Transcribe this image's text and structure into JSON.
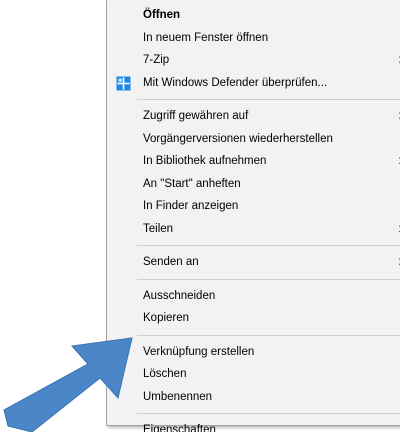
{
  "context_menu": {
    "groups": [
      [
        {
          "label": "Öffnen",
          "bold": true
        },
        {
          "label": "In neuem Fenster öffnen"
        },
        {
          "label": "7-Zip",
          "submenu": true
        },
        {
          "label": "Mit Windows Defender überprüfen...",
          "icon": "windows-defender-icon"
        }
      ],
      [
        {
          "label": "Zugriff gewähren auf",
          "submenu": true
        },
        {
          "label": "Vorgängerversionen wiederherstellen"
        },
        {
          "label": "In Bibliothek aufnehmen",
          "submenu": true
        },
        {
          "label": "An \"Start\" anheften"
        },
        {
          "label": "In Finder anzeigen"
        },
        {
          "label": "Teilen",
          "submenu": true
        }
      ],
      [
        {
          "label": "Senden an",
          "submenu": true
        }
      ],
      [
        {
          "label": "Ausschneiden"
        },
        {
          "label": "Kopieren"
        }
      ],
      [
        {
          "label": "Verknüpfung erstellen"
        },
        {
          "label": "Löschen"
        },
        {
          "label": "Umbenennen"
        }
      ],
      [
        {
          "label": "Eigenschaften"
        }
      ]
    ],
    "submenu_glyph": ">"
  },
  "colors": {
    "menu_background": "#f2f2f2",
    "separator": "#cfcfcf",
    "arrow": "#4a86c8",
    "defender_icon": "#1e88e5"
  },
  "pointer_arrow": {
    "icon": "blue-arrow-icon",
    "points_to": "Löschen"
  }
}
